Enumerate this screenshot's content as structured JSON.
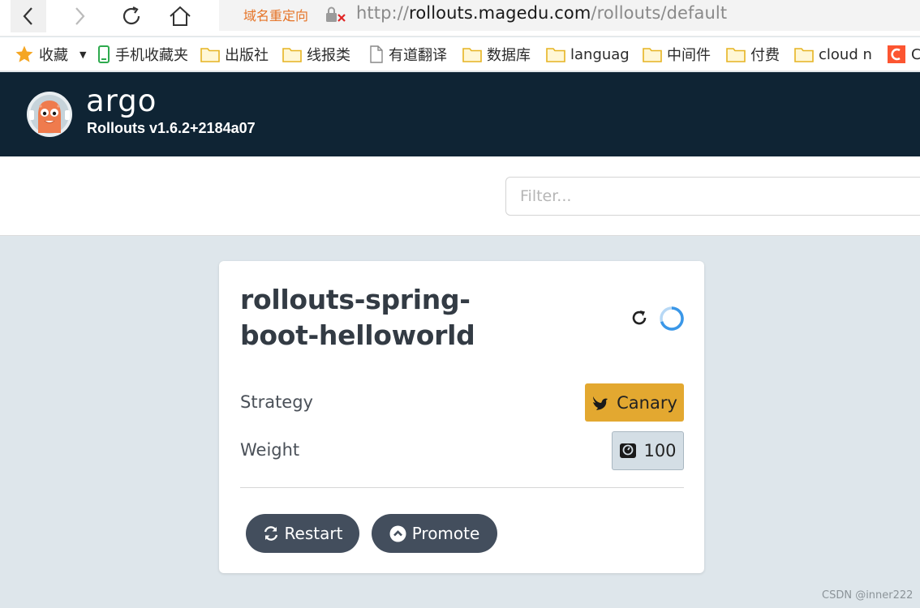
{
  "browser": {
    "redirect_label": "域名重定向",
    "url_prefix": "http://",
    "url_host": "rollouts.magedu.com",
    "url_path": "/rollouts/default"
  },
  "bookmarks": [
    {
      "label": "收藏",
      "icon": "star-icon"
    },
    {
      "label": "手机收藏夹",
      "icon": "phone-icon"
    },
    {
      "label": "出版社",
      "icon": "folder-icon"
    },
    {
      "label": "线报类",
      "icon": "folder-icon"
    },
    {
      "label": "有道翻译",
      "icon": "page-icon"
    },
    {
      "label": "数据库",
      "icon": "folder-icon"
    },
    {
      "label": "languag",
      "icon": "folder-icon"
    },
    {
      "label": "中间件",
      "icon": "folder-icon"
    },
    {
      "label": "付费",
      "icon": "folder-icon"
    },
    {
      "label": "cloud n",
      "icon": "folder-icon"
    },
    {
      "label": "C",
      "icon": "csdn-icon"
    }
  ],
  "app": {
    "brand": "argo",
    "version": "Rollouts v1.6.2+2184a07"
  },
  "filter": {
    "placeholder": "Filter...",
    "value": ""
  },
  "rollout": {
    "name": "rollouts-spring-boot-helloworld",
    "strategy_label": "Strategy",
    "strategy_value": "Canary",
    "weight_label": "Weight",
    "weight_value": "100",
    "restart_label": "Restart",
    "promote_label": "Promote"
  },
  "colors": {
    "header_bg": "#0f2434",
    "canary": "#e3a830",
    "button_bg": "#434e5d",
    "page_bg": "#dee6eb",
    "spinner": "#3a97e8"
  },
  "watermark": "CSDN @inner222"
}
